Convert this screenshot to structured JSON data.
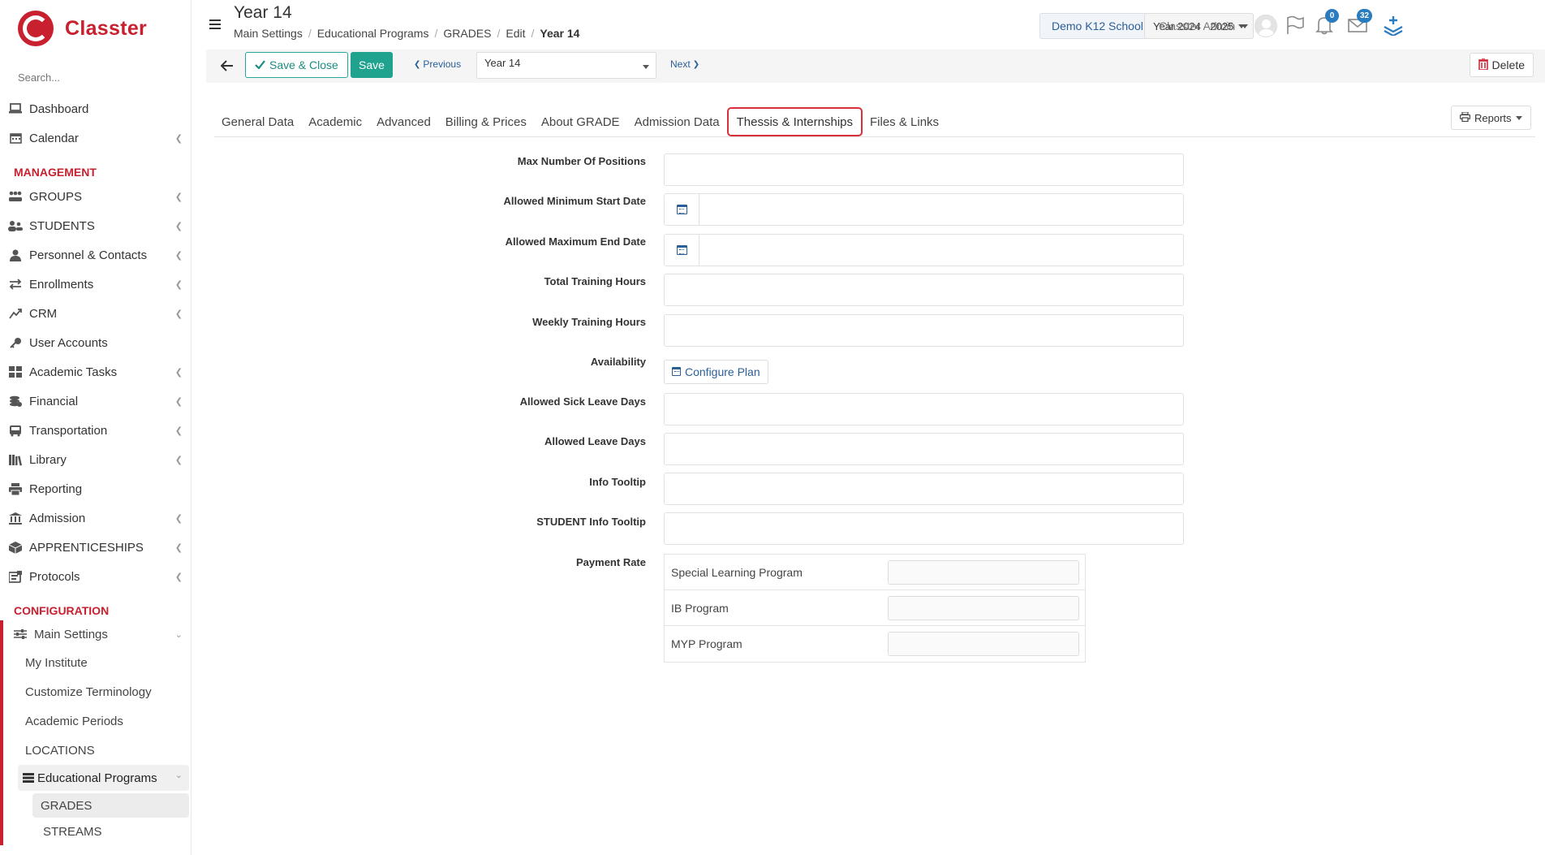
{
  "brand": {
    "name": "Classter"
  },
  "sidebar": {
    "search_placeholder": "Search...",
    "items": [
      {
        "label": "Dashboard",
        "icon": "laptop-icon",
        "chevron": false
      },
      {
        "label": "Calendar",
        "icon": "calendar-icon",
        "chevron": true
      }
    ],
    "management_label": "MANAGEMENT",
    "management_items": [
      {
        "label": "GROUPS",
        "icon": "groups-icon"
      },
      {
        "label": "STUDENTS",
        "icon": "students-icon"
      },
      {
        "label": "Personnel & Contacts",
        "icon": "personnel-icon"
      },
      {
        "label": "Enrollments",
        "icon": "exchange-icon"
      },
      {
        "label": "CRM",
        "icon": "crm-icon"
      },
      {
        "label": "User Accounts",
        "icon": "key-icon"
      },
      {
        "label": "Academic Tasks",
        "icon": "tasks-icon"
      },
      {
        "label": "Financial",
        "icon": "coins-icon"
      },
      {
        "label": "Transportation",
        "icon": "bus-icon"
      },
      {
        "label": "Library",
        "icon": "books-icon"
      },
      {
        "label": "Reporting",
        "icon": "print-icon"
      },
      {
        "label": "Admission",
        "icon": "bank-icon"
      },
      {
        "label": "APPRENTICESHIPS",
        "icon": "box-icon"
      },
      {
        "label": "Protocols",
        "icon": "protocols-icon"
      }
    ],
    "management_chevrons": [
      true,
      true,
      true,
      true,
      true,
      false,
      true,
      true,
      true,
      true,
      false,
      true,
      true,
      true
    ],
    "configuration_label": "CONFIGURATION",
    "main_settings": "Main Settings",
    "config_items": [
      "My Institute",
      "Customize Terminology",
      "Academic Periods",
      "LOCATIONS"
    ],
    "educational_programs": "Educational Programs",
    "edu_sub_items": [
      "GRADES",
      "STREAMS"
    ]
  },
  "header": {
    "title": "Year 14",
    "breadcrumb": [
      "Main Settings",
      "Educational Programs",
      "GRADES",
      "Edit",
      "Year 14"
    ],
    "school": "Demo K12 School",
    "year": "Year 2024 - 2025",
    "notifications_count": "0",
    "messages_count": "32",
    "user": "Classter Admin"
  },
  "toolbar": {
    "save_close": "Save & Close",
    "save": "Save",
    "previous": "Previous",
    "select_value": "Year 14",
    "next": "Next",
    "delete": "Delete"
  },
  "tabs": [
    "General Data",
    "Academic",
    "Advanced",
    "Billing & Prices",
    "About GRADE",
    "Admission Data",
    "Thessis & Internships",
    "Files & Links"
  ],
  "active_tab": "Thessis & Internships",
  "reports_label": "Reports",
  "form": {
    "max_positions": "Max Number Of Positions",
    "min_start": "Allowed Minimum Start Date",
    "max_end": "Allowed Maximum End Date",
    "total_hours": "Total Training Hours",
    "weekly_hours": "Weekly Training Hours",
    "availability": "Availability",
    "configure_plan": "Configure Plan",
    "sick_leave": "Allowed Sick Leave Days",
    "leave_days": "Allowed Leave Days",
    "info_tooltip": "Info Tooltip",
    "student_tooltip": "STUDENT Info Tooltip",
    "payment_rate": "Payment Rate",
    "rate_programs": [
      "Special Learning Program",
      "IB Program",
      "MYP Program"
    ]
  },
  "colors": {
    "brand": "#c8202f",
    "accent_green": "#1fa38f",
    "link_blue": "#2a5f98",
    "badge_blue": "#2b7bbf"
  }
}
